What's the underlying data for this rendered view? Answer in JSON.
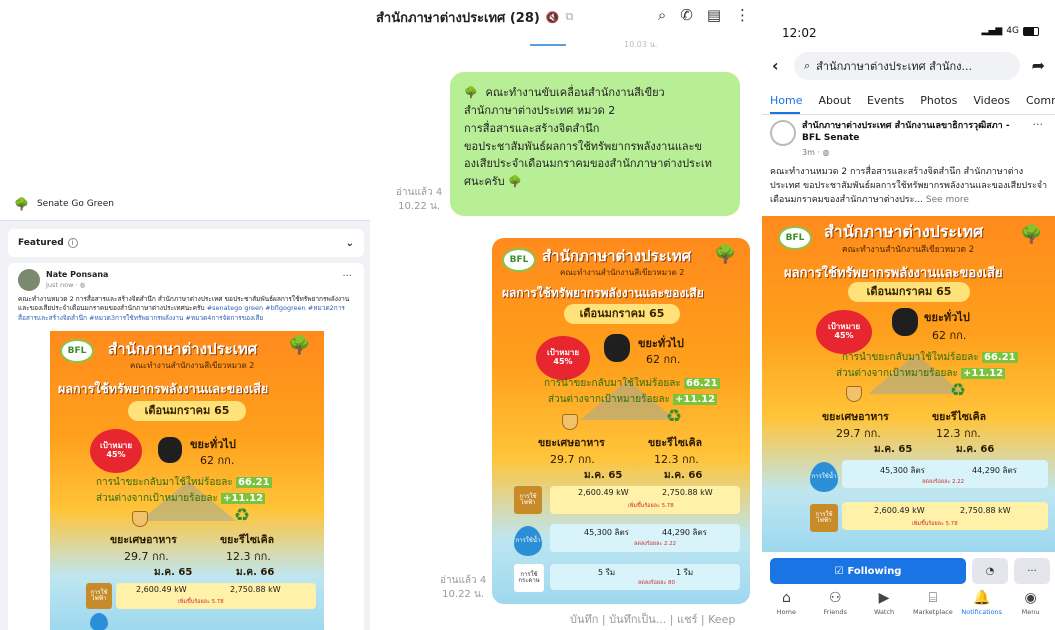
{
  "left": {
    "page_name": "Senate Go Green",
    "featured_label": "Featured",
    "author": "Nate Ponsana",
    "time": "Just now · ",
    "text": "คณะทำงานหมวด 2 การสื่อสารและสร้างจิตสำนึก สำนักภาษาต่างประเทศ ขอประชาสัมพันธ์ผลการใช้ทรัพยากรพลังงานและของเสียประจำเดือนมกราคมของสำนักภาษาต่างประเทศนะครับ",
    "tags": "#senatego green #bflgogreen #หมวด2การสื่อสารและสร้างจิตสำนึก #หมวด3การใช้ทรัพยากรพลังงาน #หมวด4การจัดการของเสีย"
  },
  "infographic": {
    "logo": "BFL",
    "title": "สำนักภาษาต่างประเทศ",
    "subtitle": "คณะทำงานสำนักงานสีเขียวหมวด 2",
    "banner": "ผลการใช้ทรัพยากรพลังงานและของเสีย",
    "month": "เดือนมกราคม 65",
    "target_line1": "เป้าหมาย",
    "target_line2": "45%",
    "general_waste_label": "ขยะทั่วไป",
    "general_waste_value": "62 กก.",
    "reuse_text": "การนำขยะกลับมาใช้ใหม่ร้อยละ",
    "reuse_value": "66.21",
    "diff_text": "ส่วนต่างจากเป้าหมายร้อยละ",
    "diff_value": "+11.12",
    "food_waste_label": "ขยะเศษอาหาร",
    "food_waste_value": "29.7 กก.",
    "recycle_label": "ขยะรีไซเคิล",
    "recycle_value": "12.3 กก.",
    "col_65": "ม.ค. 65",
    "col_66": "ม.ค. 66",
    "elec_tag": "การใช้ไฟฟ้า",
    "elec_65": "2,600.49 kW",
    "elec_66": "2,750.88 kW",
    "elec_change": "เพิ่มขึ้นร้อยละ 5.78",
    "water_tag": "การใช้น้ำ",
    "water_65": "45,300 ลิตร",
    "water_66": "44,290 ลิตร",
    "water_change": "ลดลงร้อยละ 2.22",
    "paper_tag": "การใช้กระดาษ",
    "paper_65": "5 รีม",
    "paper_66": "1 รีม",
    "paper_change": "ลดลงร้อยละ 80"
  },
  "mid": {
    "chat_title": "สำนักภาษาต่างประเทศ (28)",
    "faded_time": "10.03 น.",
    "bubble_lines": [
      "คณะทำงานขับเคลื่อนสำนักงานสีเขียว",
      "สำนักภาษาต่างประเทศ หมวด 2",
      "การสื่อสารและสร้างจิตสำนึก",
      "ขอประชาสัมพันธ์ผลการใช้ทรัพยากรพลังงานและข",
      "องเสียประจำเดือนมกราคมของสำนักภาษาต่างประเท",
      "ศนะครับ"
    ],
    "read1": "อ่านแล้ว 4",
    "time1": "10.22 น.",
    "read2": "อ่านแล้ว 4",
    "time2": "10.22 น.",
    "bottom_actions": "บันทึก | บันทึกเป็น... | แชร์ | Keep"
  },
  "right": {
    "clock": "12:02",
    "signal": "4G",
    "search_text": "สำนักภาษาต่างประเทศ สำนักง...",
    "tabs": [
      "Home",
      "About",
      "Events",
      "Photos",
      "Videos",
      "Comm"
    ],
    "page_name": "สำนักภาษาต่างประเทศ สำนักงานเลขาธิการวุฒิสภา - BFL Senate",
    "page_time": "3m · ",
    "post_text": "คณะทำงานหมวด 2 การสื่อสารและสร้างจิตสำนึก สำนักภาษาต่างประเทศ ขอประชาสัมพันธ์ผลการใช้ทรัพยากรพลังงานและของเสียประจำเดือนมกราคมของสำนักภาษาต่างประ...",
    "see_more": "See more",
    "following": "Following",
    "nav": [
      "Home",
      "Friends",
      "Watch",
      "Marketplace",
      "Notifications",
      "Menu"
    ]
  }
}
